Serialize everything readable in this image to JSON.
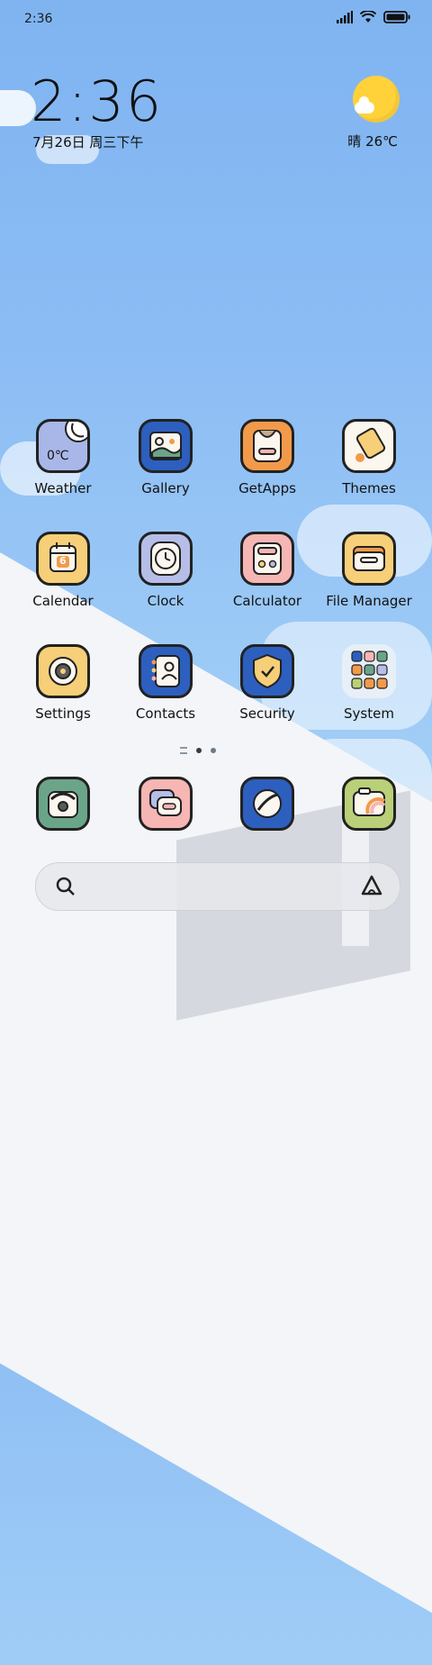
{
  "status_bar": {
    "time": "2:36"
  },
  "clock": {
    "time": "2:36",
    "date": "7月26日 周三下午"
  },
  "weather_widget": {
    "text": "晴 26℃"
  },
  "apps": [
    {
      "name": "weather",
      "label": "Weather",
      "tile_text": "0℃",
      "color": "#a9b7e8"
    },
    {
      "name": "gallery",
      "label": "Gallery",
      "color": "#2d5fbf"
    },
    {
      "name": "getapps",
      "label": "GetApps",
      "color": "#f29a4a"
    },
    {
      "name": "themes",
      "label": "Themes",
      "color": "#fbf6ee"
    },
    {
      "name": "calendar",
      "label": "Calendar",
      "tile_text": "6",
      "color": "#f6cf78"
    },
    {
      "name": "clock",
      "label": "Clock",
      "color": "#b6bee8"
    },
    {
      "name": "calculator",
      "label": "Calculator",
      "color": "#f6b6b4"
    },
    {
      "name": "file-manager",
      "label": "File Manager",
      "color": "#f6cf78"
    },
    {
      "name": "settings",
      "label": "Settings",
      "color": "#f6cf78"
    },
    {
      "name": "contacts",
      "label": "Contacts",
      "color": "#2d5fbf"
    },
    {
      "name": "security",
      "label": "Security",
      "color": "#2d5fbf"
    },
    {
      "name": "system",
      "label": "System",
      "color": "#eef1f6"
    }
  ],
  "dock": [
    {
      "name": "phone",
      "color": "#6aa58a"
    },
    {
      "name": "messages",
      "color": "#f6b6b4"
    },
    {
      "name": "browser",
      "color": "#2d5fbf"
    },
    {
      "name": "camera",
      "color": "#b9cf78"
    }
  ],
  "page_indicator": {
    "pages": 2,
    "active": 1
  }
}
